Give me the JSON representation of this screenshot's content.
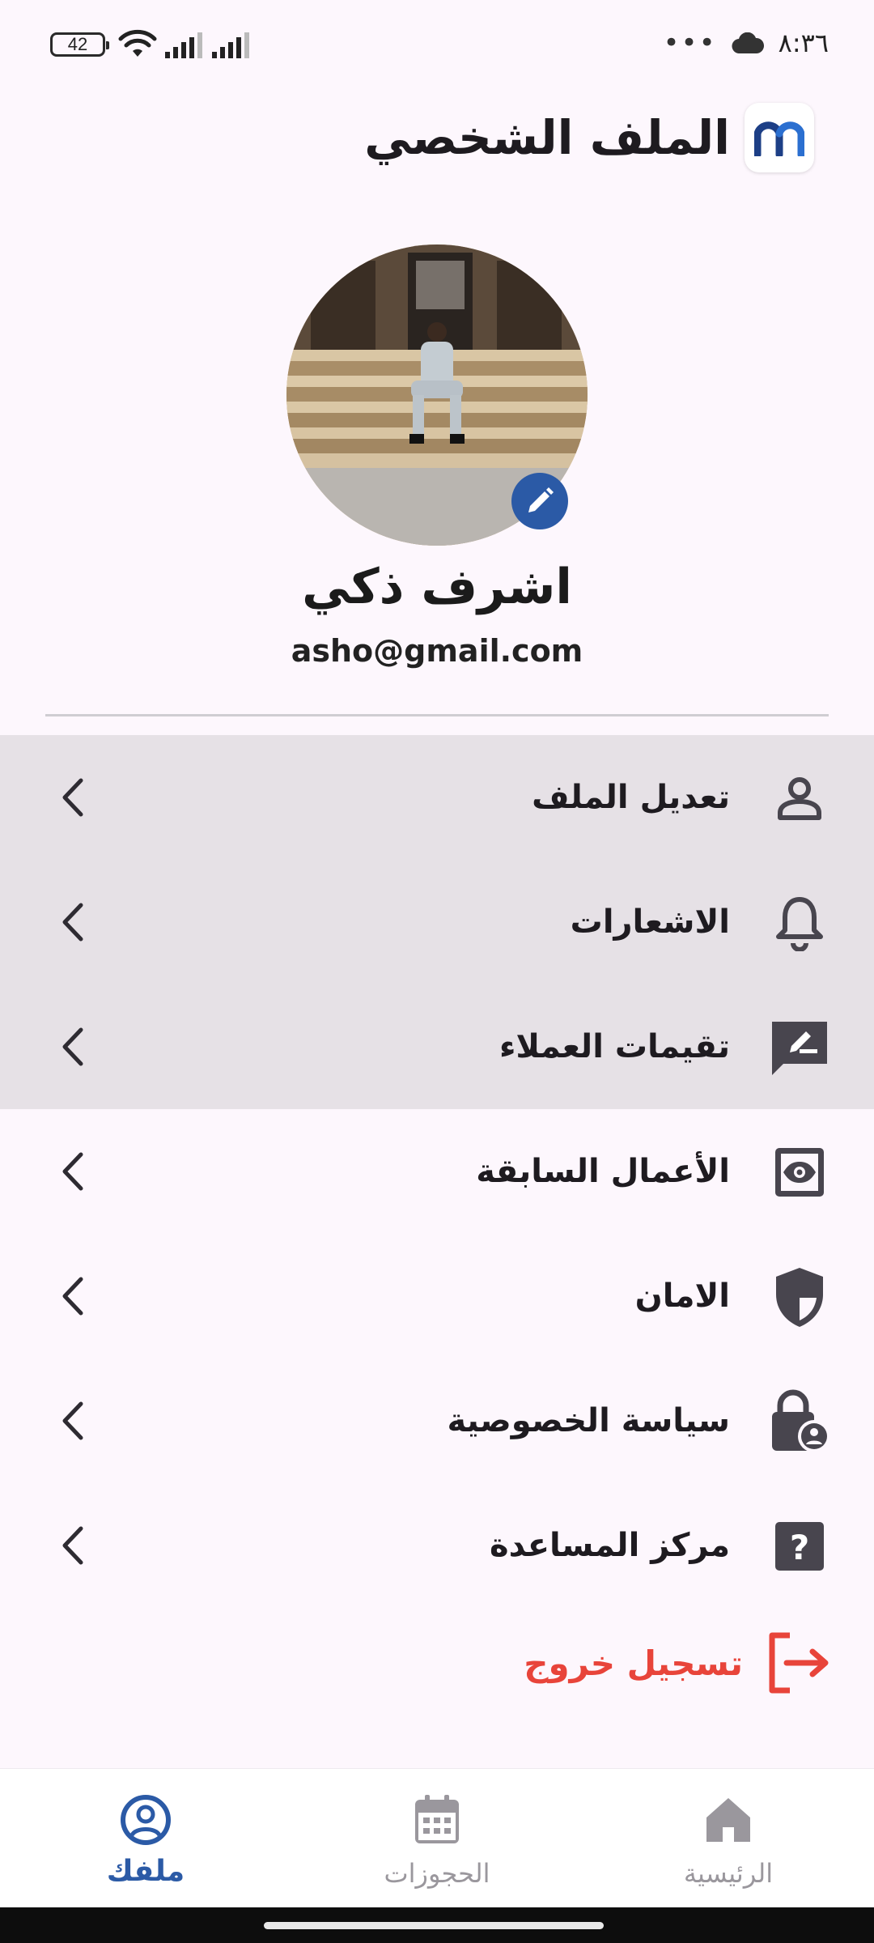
{
  "status_bar": {
    "battery": "42",
    "time": "٨:٣٦",
    "dots": "•••"
  },
  "header": {
    "title": "الملف الشخصي"
  },
  "profile": {
    "name": "اشرف ذكي",
    "email": "asho@gmail.com"
  },
  "menu": {
    "items": [
      {
        "label": "تعديل الملف",
        "icon": "person-outline-icon"
      },
      {
        "label": "الاشعارات",
        "icon": "bell-icon"
      },
      {
        "label": "تقيمات العملاء",
        "icon": "rate-review-icon"
      },
      {
        "label": "الأعمال السابقة",
        "icon": "eye-card-icon"
      },
      {
        "label": "الامان",
        "icon": "shield-icon"
      },
      {
        "label": "سياسة الخصوصية",
        "icon": "lock-person-icon"
      },
      {
        "label": "مركز المساعدة",
        "icon": "help-box-icon"
      }
    ],
    "logout_label": "تسجيل خروج"
  },
  "bottom_nav": {
    "profile_label": "ملفك",
    "bookings_label": "الحجوزات",
    "home_label": "الرئيسية",
    "active": "profile"
  },
  "colors": {
    "accent": "#2b5aa6",
    "danger": "#e8443a",
    "background": "#fdf7fd",
    "shaded_row": "#e6e1e6",
    "icon_dark": "#48454e"
  }
}
